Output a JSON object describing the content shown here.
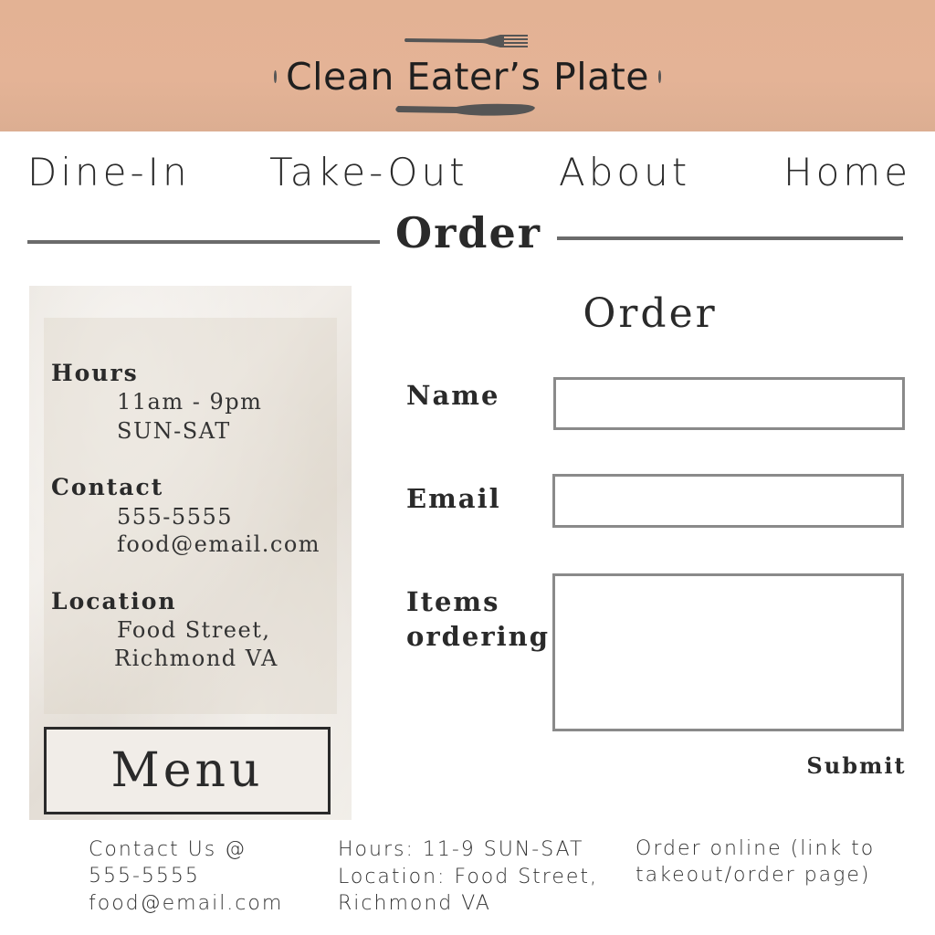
{
  "header": {
    "title": "Clean Eater’s Plate",
    "fork_icon": "fork-icon",
    "knife_icon": "knife-icon",
    "background_color": "#e4b396",
    "icon_color": "#555555"
  },
  "nav": {
    "items": [
      {
        "label": "Dine-In"
      },
      {
        "label": "Take-Out"
      },
      {
        "label": "About"
      },
      {
        "label": "Home"
      }
    ]
  },
  "section": {
    "title": "Order"
  },
  "info": {
    "hours_label": "Hours",
    "hours_time": "11am - 9pm",
    "hours_days": "SUN-SAT",
    "contact_label": "Contact",
    "contact_phone": "555-5555",
    "contact_email": "food@email.com",
    "location_label": "Location",
    "location_line1": "Food Street,",
    "location_line2": "Richmond VA",
    "menu_button": "Menu"
  },
  "form": {
    "title": "Order",
    "name_label": "Name",
    "name_value": "",
    "email_label": "Email",
    "email_value": "",
    "items_label_line1": "Items",
    "items_label_line2": "ordering",
    "items_value": "",
    "submit_label": "Submit"
  },
  "footer": {
    "contact_line1": "Contact Us @",
    "contact_line2": "555-5555",
    "contact_line3": "food@email.com",
    "hours_line1": "Hours: 11-9 SUN-SAT",
    "hours_line2": "Location: Food Street,",
    "hours_line3": "Richmond VA",
    "order_line1": "Order online (link to",
    "order_line2": "takeout/order page)"
  }
}
